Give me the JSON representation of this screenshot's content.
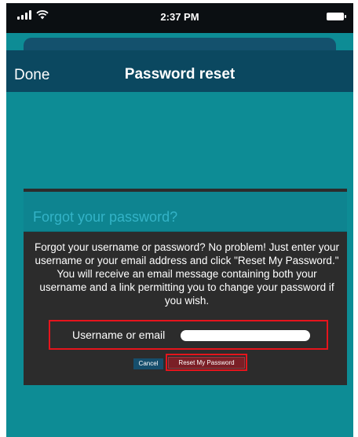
{
  "status_bar": {
    "time": "2:37 PM"
  },
  "navbar": {
    "done_label": "Done",
    "title": "Password reset"
  },
  "dialog": {
    "title": "Forgot your password?",
    "message": "Forgot your username or password? No problem! Just enter your username or your email address and click \"Reset My Password.\" You will receive an email message containing both your username and a link permitting you to change your password if you wish.",
    "field_label": "Username or email",
    "field_value": "",
    "cancel_label": "Cancel",
    "reset_label": "Reset My Password"
  },
  "colors": {
    "background": "#0d8c95",
    "navbar": "#0b4860",
    "dialog": "#2c2c2c",
    "dialog_title": "#33b3c7",
    "highlight": "#e6141c",
    "reset_button": "#7a1f26",
    "cancel_button": "#164e6c"
  },
  "icons": [
    "signal-icon",
    "wifi-icon",
    "battery-icon"
  ]
}
